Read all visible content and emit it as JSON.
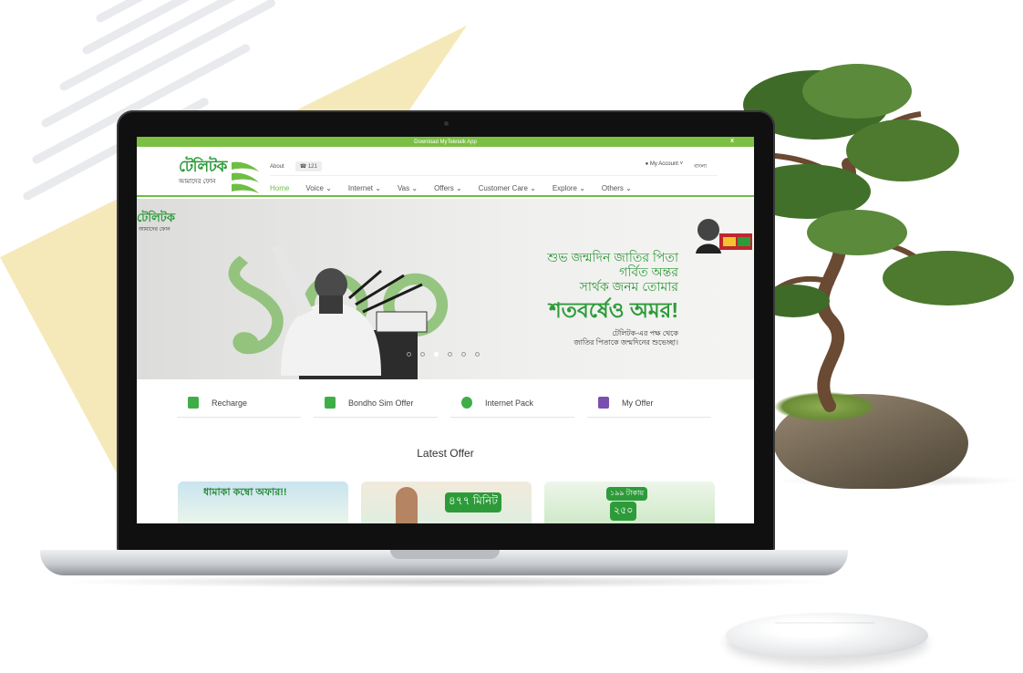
{
  "site": {
    "download_bar": "Download MyTeletalk App",
    "download_close": "x",
    "logo_text": "টেলিটক",
    "logo_tagline": "আমাদের ফোন",
    "util": {
      "about": "About",
      "hotline": "121"
    },
    "account": {
      "my_account": "My Account",
      "language": "বাংলা"
    },
    "nav": [
      {
        "label": "Home"
      },
      {
        "label": "Voice"
      },
      {
        "label": "Internet"
      },
      {
        "label": "Vas"
      },
      {
        "label": "Offers"
      },
      {
        "label": "Customer Care"
      },
      {
        "label": "Explore"
      },
      {
        "label": "Others"
      }
    ],
    "hero": {
      "line1": "শুভ জন্মদিন জাতির পিতা",
      "line2": "গর্বিত অন্তর",
      "line3": "সার্থক জনম তোমার",
      "line4": "শতবর্ষেও অমর!",
      "line5": "টেলিটক-এর পক্ষ থেকে",
      "line6": "জাতির পিতাকে জন্মদিনের শুভেচ্ছা।",
      "logo_text": "টেলিটক",
      "logo_tagline": "আমাদের ফোন",
      "big_number": "১০০",
      "active_slide": 3,
      "slides": 6
    },
    "quick_links": [
      {
        "label": "Recharge",
        "icon": "phone-recharge-icon",
        "color": "#3fae49"
      },
      {
        "label": "Bondho Sim Offer",
        "icon": "sim-card-icon",
        "color": "#3fae49"
      },
      {
        "label": "Internet Pack",
        "icon": "globe-icon",
        "color": "#3fae49"
      },
      {
        "label": "My Offer",
        "icon": "gift-icon",
        "color": "#7a4fb0"
      }
    ],
    "latest_offer": "Latest Offer",
    "cards": [
      {
        "headline": "ধামাকা কম্বো অফার!!",
        "badge": ""
      },
      {
        "headline": "৪৭৭ মিনিট",
        "badge": ""
      },
      {
        "headline": "২৫০",
        "badge": "১৯৯ টাকায়"
      }
    ]
  },
  "colors": {
    "brand_green": "#6fbe44",
    "logo_green": "#2e9b3a",
    "tree_green": "#4d7a2e",
    "mat_yellow": "#f3e7b8"
  }
}
